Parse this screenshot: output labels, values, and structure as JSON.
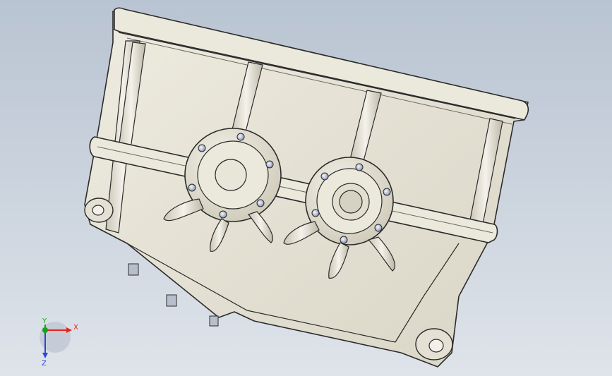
{
  "viewport": {
    "background_top": "#b9c4d2",
    "background_bottom": "#dfe4ea"
  },
  "model": {
    "body_fill": "#e6e3d6",
    "body_shade": "#cfcbbb",
    "edge_color": "#2b2b2b"
  },
  "triad": {
    "x_label": "X",
    "y_label": "Y",
    "z_label": "Z",
    "x_color": "#e8231c",
    "y_color": "#16a316",
    "z_color": "#2848d6"
  }
}
